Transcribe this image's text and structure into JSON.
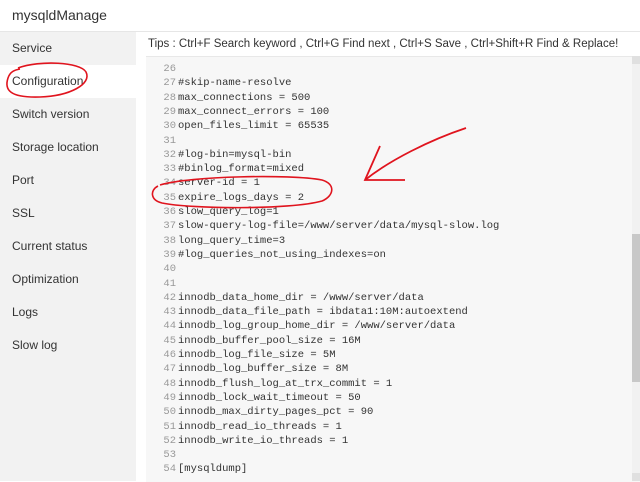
{
  "window": {
    "title": "mysqldManage"
  },
  "sidebar": {
    "items": [
      {
        "label": "Service"
      },
      {
        "label": "Configuration"
      },
      {
        "label": "Switch version"
      },
      {
        "label": "Storage location"
      },
      {
        "label": "Port"
      },
      {
        "label": "SSL"
      },
      {
        "label": "Current status"
      },
      {
        "label": "Optimization"
      },
      {
        "label": "Logs"
      },
      {
        "label": "Slow log"
      }
    ],
    "active_index": 1
  },
  "tips": "Tips : Ctrl+F Search keyword , Ctrl+G Find next , Ctrl+S Save , Ctrl+Shift+R Find & Replace!",
  "editor": {
    "lines": [
      {
        "num": "26",
        "text": ""
      },
      {
        "num": "27",
        "text": "#skip-name-resolve"
      },
      {
        "num": "28",
        "text": "max_connections = 500"
      },
      {
        "num": "29",
        "text": "max_connect_errors = 100"
      },
      {
        "num": "30",
        "text": "open_files_limit = 65535"
      },
      {
        "num": "31",
        "text": ""
      },
      {
        "num": "32",
        "text": "#log-bin=mysql-bin"
      },
      {
        "num": "33",
        "text": "#binlog_format=mixed"
      },
      {
        "num": "34",
        "text": "server-id = 1"
      },
      {
        "num": "35",
        "text": "expire_logs_days = 2"
      },
      {
        "num": "36",
        "text": "slow_query_log=1"
      },
      {
        "num": "37",
        "text": "slow-query-log-file=/www/server/data/mysql-slow.log"
      },
      {
        "num": "38",
        "text": "long_query_time=3"
      },
      {
        "num": "39",
        "text": "#log_queries_not_using_indexes=on"
      },
      {
        "num": "40",
        "text": ""
      },
      {
        "num": "41",
        "text": ""
      },
      {
        "num": "42",
        "text": "innodb_data_home_dir = /www/server/data"
      },
      {
        "num": "43",
        "text": "innodb_data_file_path = ibdata1:10M:autoextend"
      },
      {
        "num": "44",
        "text": "innodb_log_group_home_dir = /www/server/data"
      },
      {
        "num": "45",
        "text": "innodb_buffer_pool_size = 16M"
      },
      {
        "num": "46",
        "text": "innodb_log_file_size = 5M"
      },
      {
        "num": "47",
        "text": "innodb_log_buffer_size = 8M"
      },
      {
        "num": "48",
        "text": "innodb_flush_log_at_trx_commit = 1"
      },
      {
        "num": "49",
        "text": "innodb_lock_wait_timeout = 50"
      },
      {
        "num": "50",
        "text": "innodb_max_dirty_pages_pct = 90"
      },
      {
        "num": "51",
        "text": "innodb_read_io_threads = 1"
      },
      {
        "num": "52",
        "text": "innodb_write_io_threads = 1"
      },
      {
        "num": "53",
        "text": ""
      },
      {
        "num": "54",
        "text": "[mysqldump]"
      }
    ]
  },
  "colors": {
    "annotation": "#e0141e",
    "active_nav": "#ffffff",
    "sidebar_bg": "#f2f2f2"
  }
}
